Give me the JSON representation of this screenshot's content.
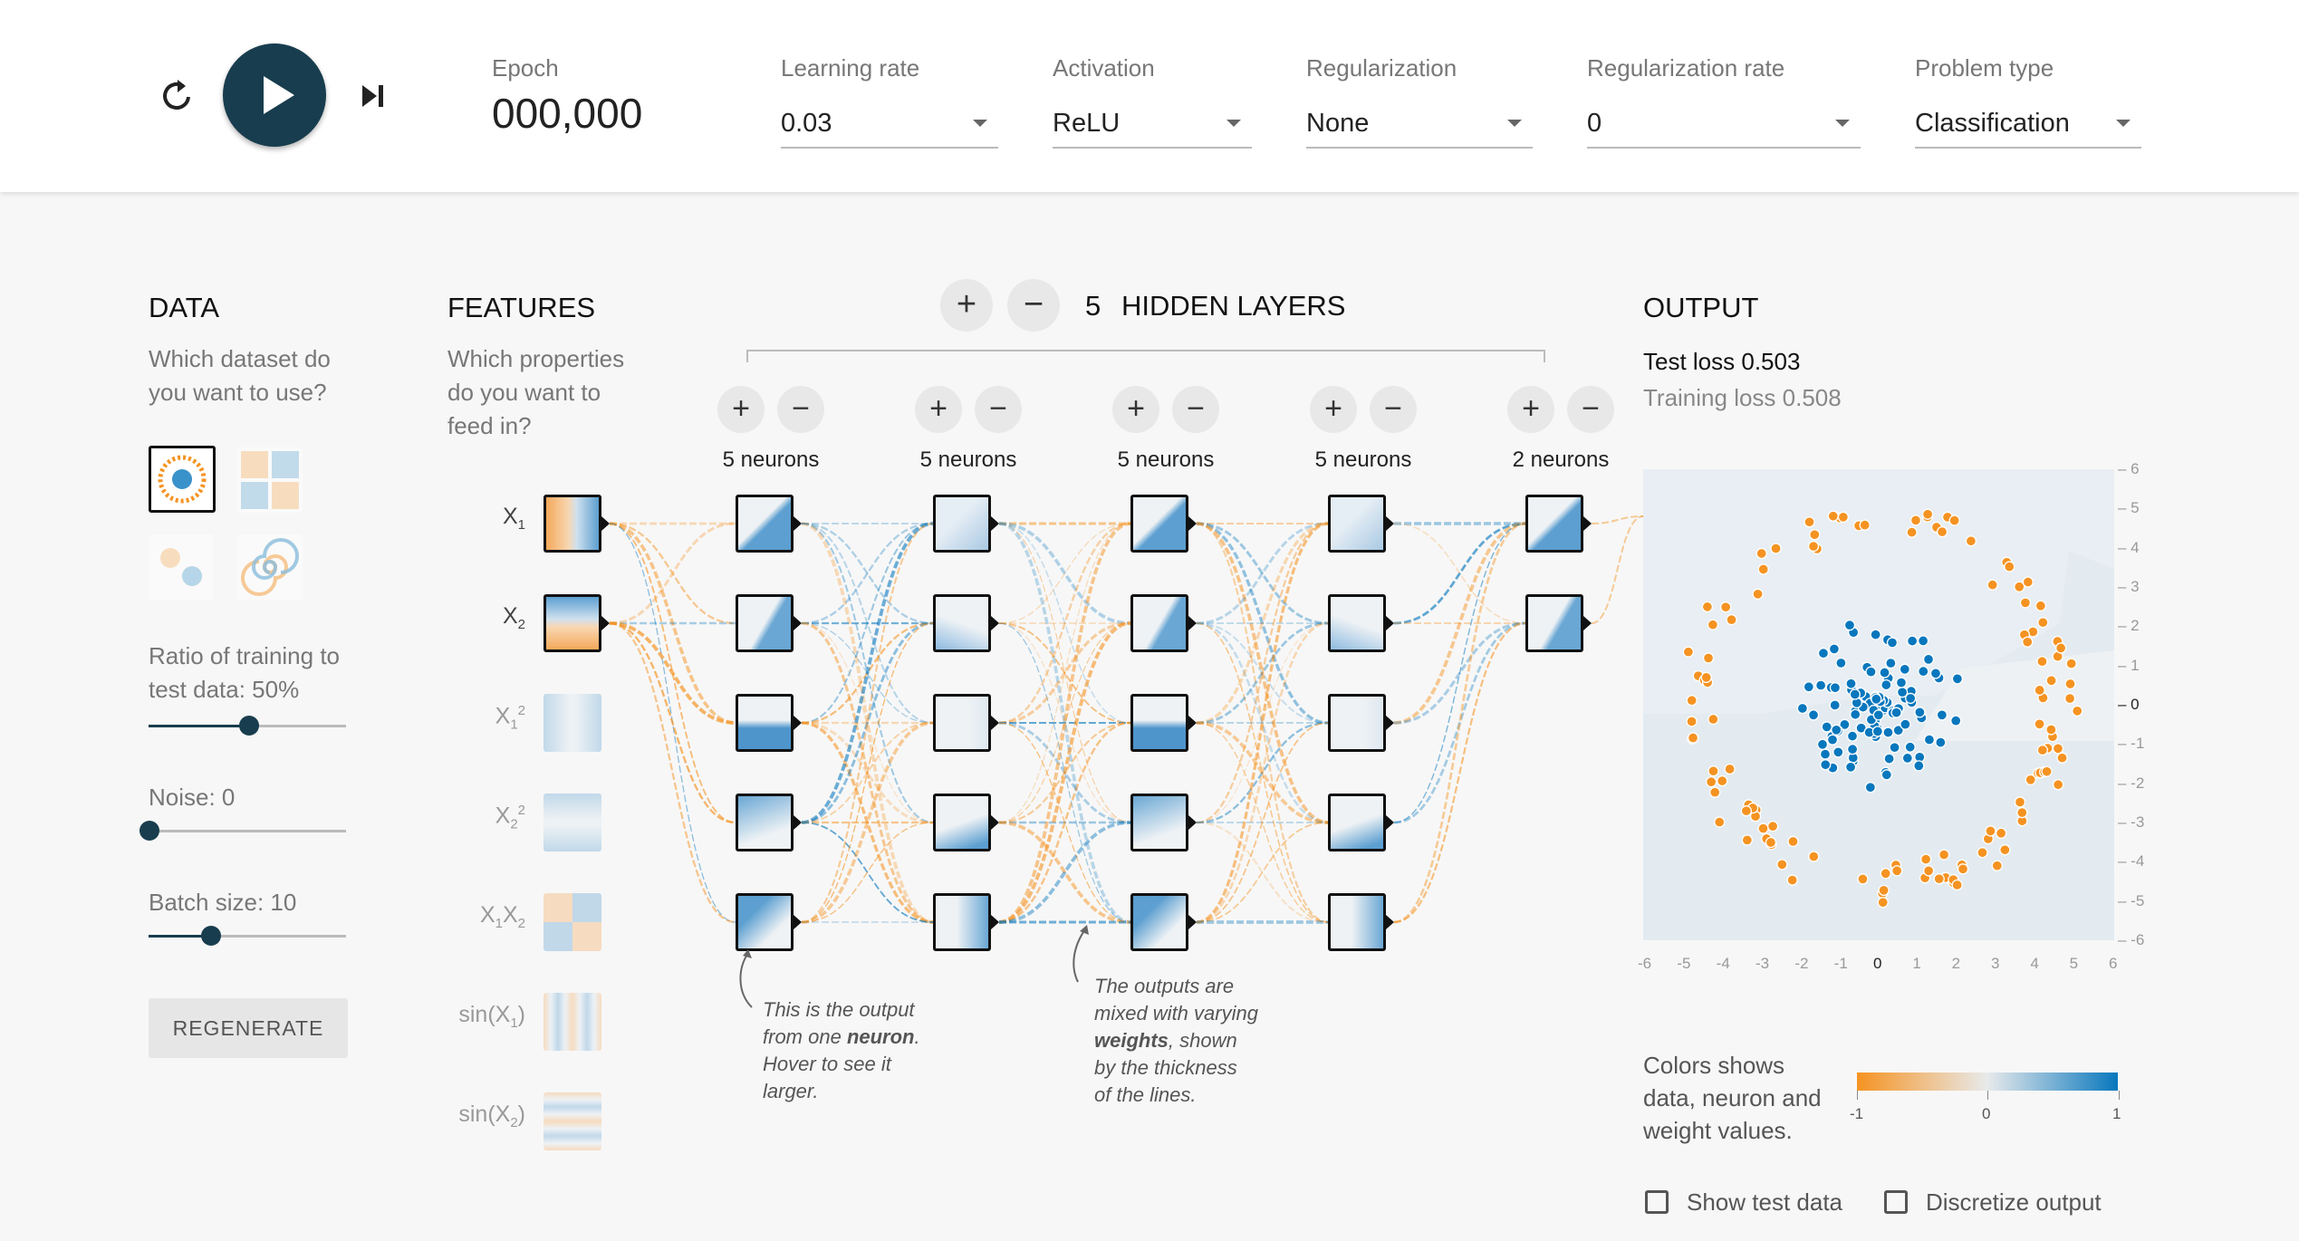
{
  "toolbar": {
    "epoch_label": "Epoch",
    "epoch_value": "000,000",
    "controls": [
      {
        "label": "Learning rate",
        "value": "0.03"
      },
      {
        "label": "Activation",
        "value": "ReLU"
      },
      {
        "label": "Regularization",
        "value": "None"
      },
      {
        "label": "Regularization rate",
        "value": "0"
      },
      {
        "label": "Problem type",
        "value": "Classification"
      }
    ],
    "icons": {
      "reset": "reset-icon",
      "play": "play-icon",
      "step": "step-forward-icon"
    }
  },
  "data_panel": {
    "title": "DATA",
    "question_line1": "Which dataset do",
    "question_line2": "you want to use?",
    "datasets": [
      "circle",
      "xor",
      "gaussian",
      "spiral"
    ],
    "selected_dataset": "circle",
    "ratio_line1": "Ratio of training to",
    "ratio_line2": "test data:  50%",
    "ratio_value": 0.5,
    "noise_label": "Noise:  0",
    "noise_value": 0,
    "batch_label": "Batch size:  10",
    "batch_value": 0.31,
    "regenerate_label": "REGENERATE"
  },
  "features_panel": {
    "title": "FEATURES",
    "question_line1": "Which properties",
    "question_line2": "do you want to",
    "question_line3": "feed in?",
    "features": [
      {
        "name": "X",
        "sub": "1",
        "sup": "",
        "active": true
      },
      {
        "name": "X",
        "sub": "2",
        "sup": "",
        "active": true
      },
      {
        "name": "X",
        "sub": "1",
        "sup": "2",
        "active": false
      },
      {
        "name": "X",
        "sub": "2",
        "sup": "2",
        "active": false
      },
      {
        "name": "X1X2",
        "sub": "",
        "sup": "",
        "active": false
      },
      {
        "name": "sin(X1)",
        "sub": "",
        "sup": "",
        "active": false
      },
      {
        "name": "sin(X2)",
        "sub": "",
        "sup": "",
        "active": false
      }
    ]
  },
  "network": {
    "layer_count": "5",
    "hidden_layers_label": "HIDDEN LAYERS",
    "layers": [
      {
        "neurons_label": "5 neurons",
        "count": 5
      },
      {
        "neurons_label": "5 neurons",
        "count": 5
      },
      {
        "neurons_label": "5 neurons",
        "count": 5
      },
      {
        "neurons_label": "5 neurons",
        "count": 5
      },
      {
        "neurons_label": "2 neurons",
        "count": 2
      }
    ],
    "note1": [
      "This is the output",
      "from one neuron.",
      "Hover to see it",
      "larger."
    ],
    "note1_bold": "neuron",
    "note2": [
      "The outputs are",
      "mixed with varying",
      "weights, shown",
      "by the thickness",
      "of the lines."
    ],
    "note2_bold": "weights"
  },
  "output_panel": {
    "title": "OUTPUT",
    "test_loss": "Test loss 0.503",
    "training_loss": "Training loss 0.508",
    "x_ticks": [
      "-6",
      "-5",
      "-4",
      "-3",
      "-2",
      "-1",
      "0",
      "1",
      "2",
      "3",
      "4",
      "5",
      "6"
    ],
    "y_ticks": [
      "6",
      "5",
      "4",
      "3",
      "2",
      "1",
      "0",
      "-1",
      "-2",
      "-3",
      "-4",
      "-5",
      "-6"
    ],
    "legend_line1": "Colors shows",
    "legend_line2": "data, neuron and",
    "legend_line3": "weight values.",
    "legend_min": "-1",
    "legend_mid": "0",
    "legend_max": "1",
    "show_test_data_label": "Show test data",
    "discretize_label": "Discretize output",
    "colors": {
      "orange": "#f59322",
      "blue": "#0877bd",
      "background": "#e8eef3"
    }
  }
}
